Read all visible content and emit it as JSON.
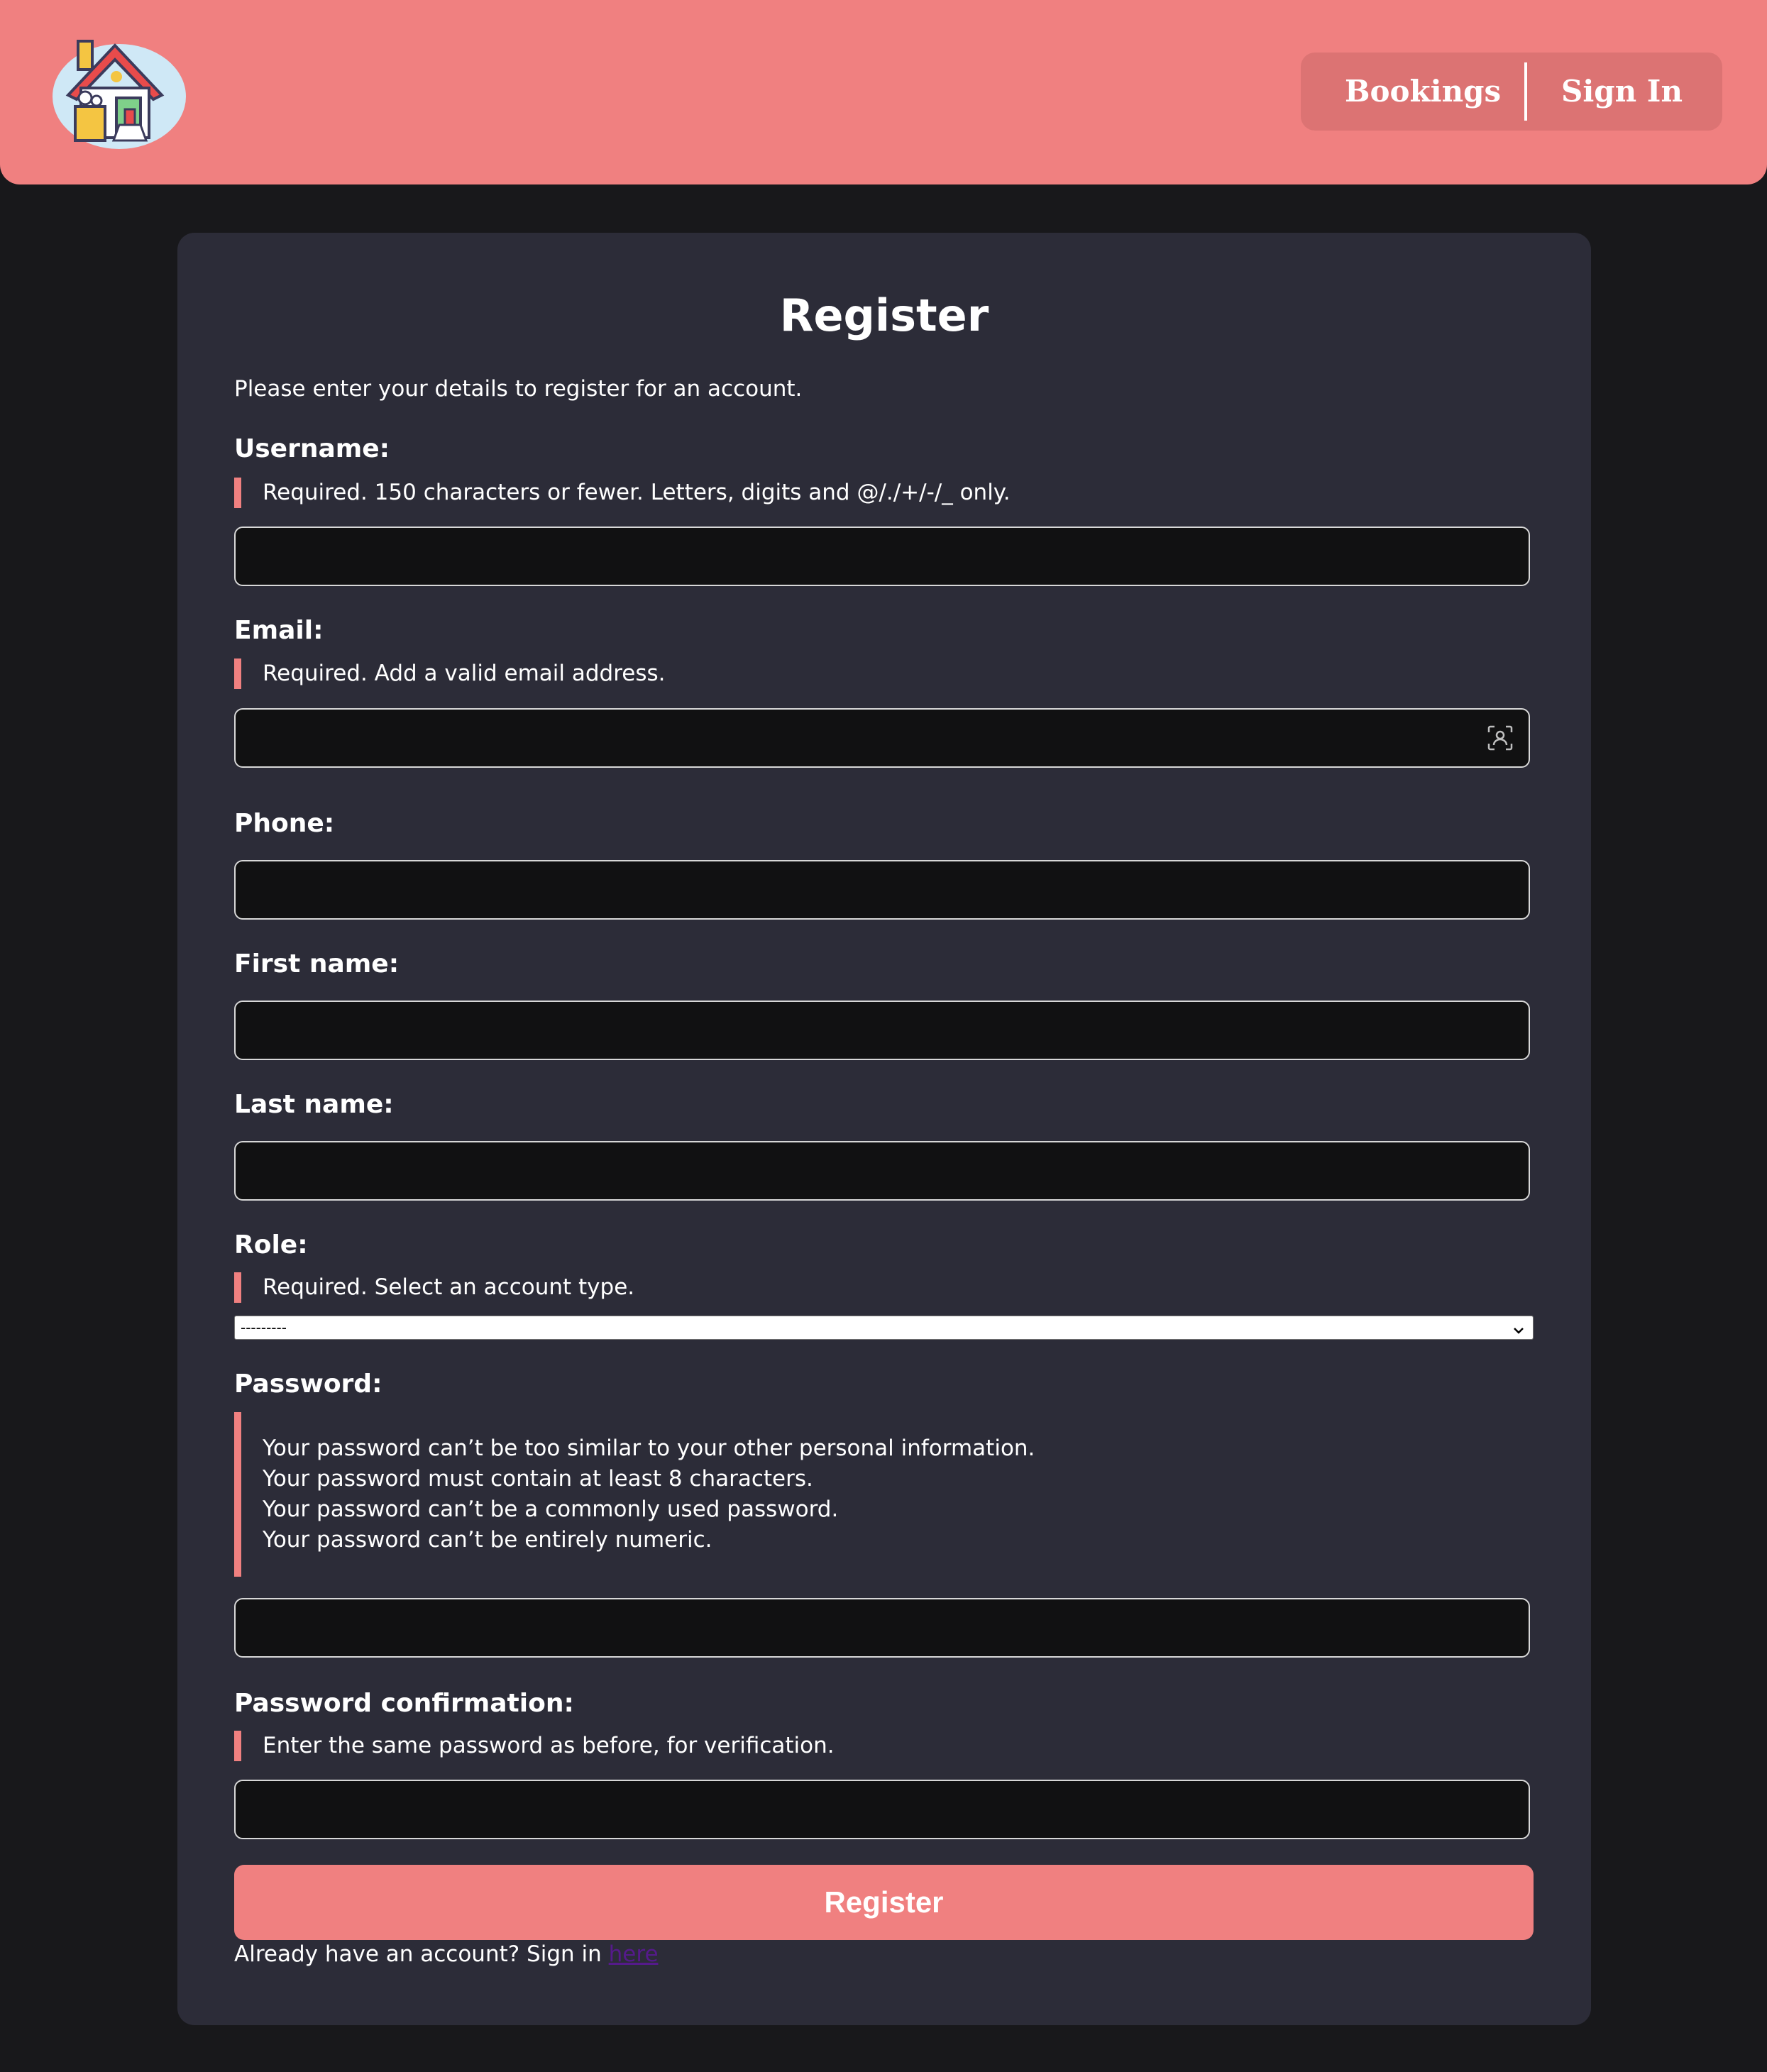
{
  "brand": {
    "logo_icon": "house-cleaning-logo",
    "accent_color": "#f08080"
  },
  "nav": {
    "bookings": "Bookings",
    "sign_in": "Sign In"
  },
  "form": {
    "title": "Register",
    "intro": "Please enter your details to register for an account.",
    "username": {
      "label": "Username:",
      "help": "Required. 150 characters or fewer. Letters, digits and @/./+/-/_ only.",
      "value": ""
    },
    "email": {
      "label": "Email:",
      "help": "Required. Add a valid email address.",
      "value": "",
      "autofill_icon": "contact-autofill-icon"
    },
    "phone": {
      "label": "Phone:",
      "value": ""
    },
    "first_name": {
      "label": "First name:",
      "value": ""
    },
    "last_name": {
      "label": "Last name:",
      "value": ""
    },
    "role": {
      "label": "Role:",
      "help": "Required. Select an account type.",
      "selected": "---------"
    },
    "password": {
      "label": "Password:",
      "help": [
        "Your password can’t be too similar to your other personal information.",
        "Your password must contain at least 8 characters.",
        "Your password can’t be a commonly used password.",
        "Your password can’t be entirely numeric."
      ],
      "value": ""
    },
    "password_confirmation": {
      "label": "Password confirmation:",
      "help": "Enter the same password as before, for verification.",
      "value": ""
    },
    "submit_label": "Register",
    "signin_prompt": "Already have an account? Sign in",
    "signin_link": "here"
  }
}
